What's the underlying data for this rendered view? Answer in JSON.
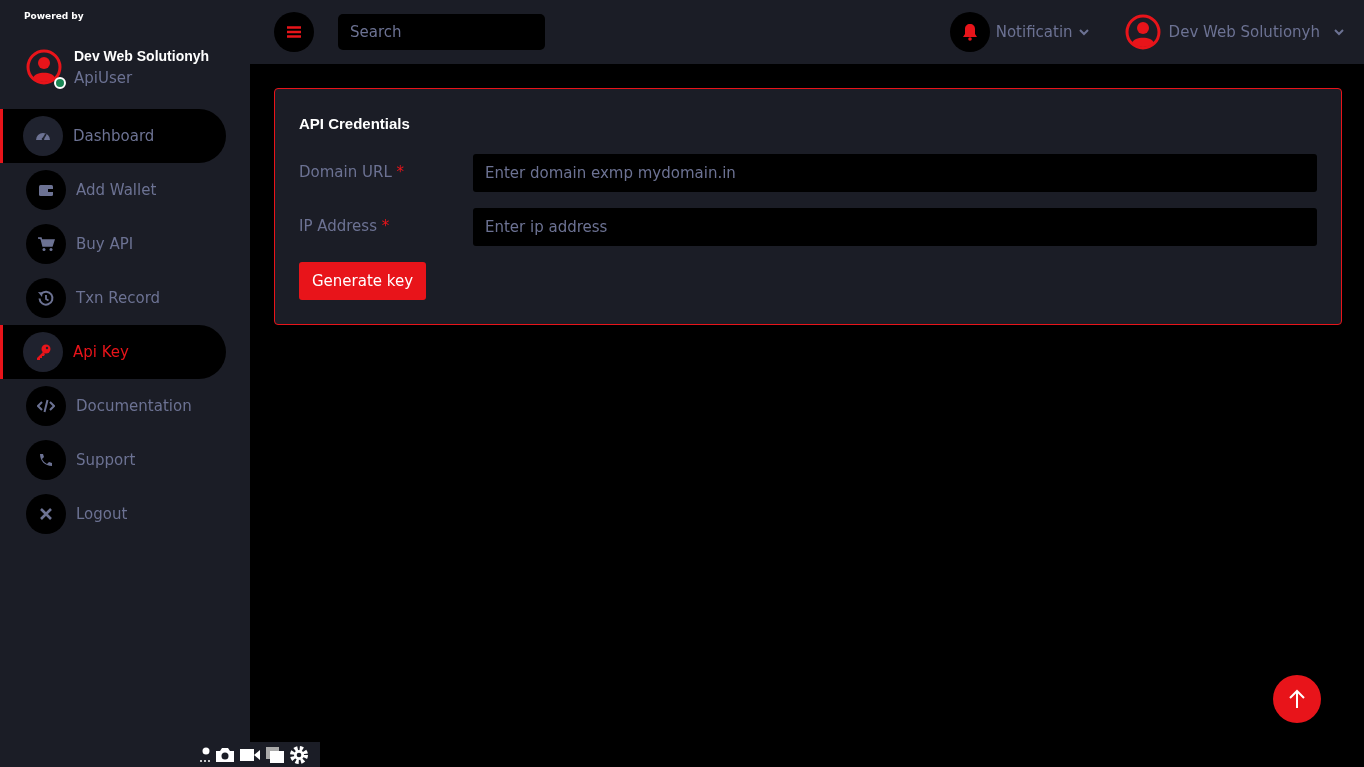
{
  "sidebar": {
    "powered_by": "Powered by",
    "user_name": "Dev Web Solutionyh",
    "user_role": "ApiUser",
    "online": true,
    "items": [
      {
        "label": "Dashboard",
        "selected": false,
        "hovered": true
      },
      {
        "label": "Add Wallet",
        "selected": false,
        "hovered": false
      },
      {
        "label": "Buy API",
        "selected": false,
        "hovered": false
      },
      {
        "label": "Txn Record",
        "selected": false,
        "hovered": false
      },
      {
        "label": "Api Key",
        "selected": true,
        "hovered": false
      },
      {
        "label": "Documentation",
        "selected": false,
        "hovered": false
      },
      {
        "label": "Support",
        "selected": false,
        "hovered": false
      },
      {
        "label": "Logout",
        "selected": false,
        "hovered": false
      }
    ]
  },
  "topbar": {
    "search": {
      "placeholder": "Search"
    },
    "notifications": "Notificatin",
    "account": "Dev Web Solutionyh"
  },
  "card": {
    "title": "API Credentials",
    "fields": [
      {
        "label": "Domain URL",
        "required_mark": "*",
        "placeholder": "Enter domain exmp mydomain.in"
      },
      {
        "label": "IP Address",
        "required_mark": "*",
        "placeholder": "Enter ip address"
      }
    ],
    "button": "Generate key"
  }
}
